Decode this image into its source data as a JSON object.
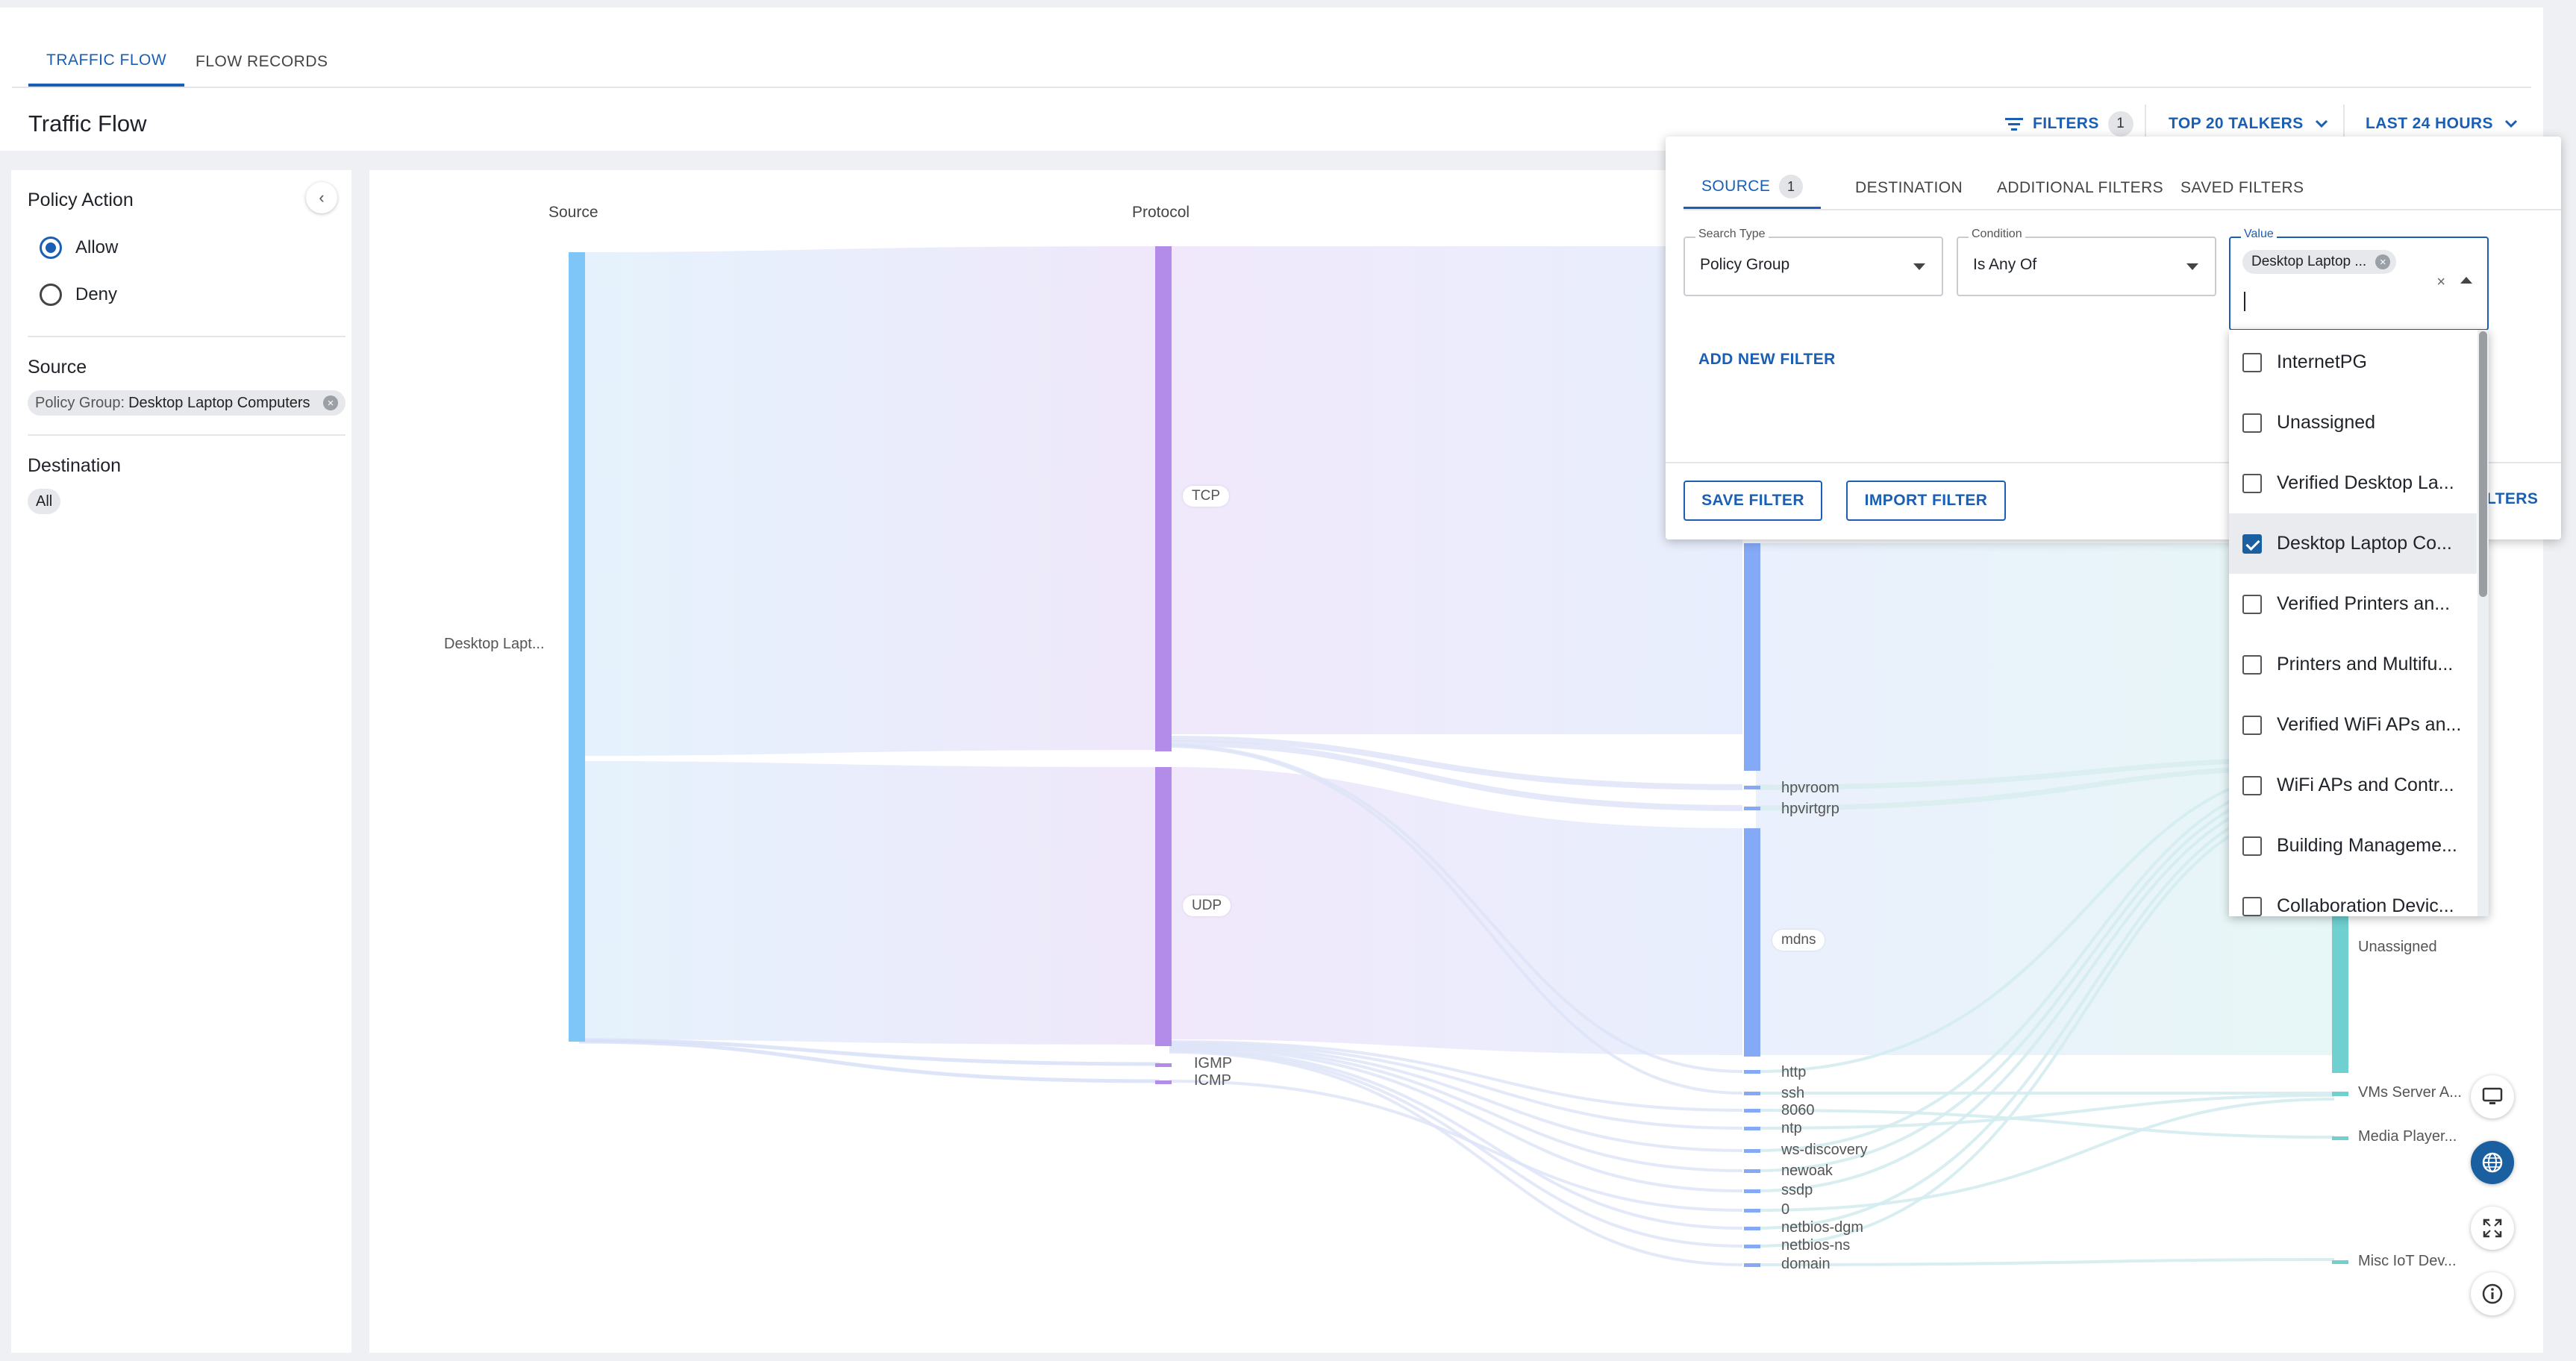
{
  "tabs": {
    "traffic_flow": "TRAFFIC FLOW",
    "flow_records": "FLOW RECORDS"
  },
  "page_title": "Traffic Flow",
  "header": {
    "filters_label": "FILTERS",
    "filters_count": "1",
    "top_talkers": "TOP 20 TALKERS",
    "time_range": "LAST 24 HOURS"
  },
  "left_panel": {
    "policy_action_title": "Policy Action",
    "allow": "Allow",
    "deny": "Deny",
    "source_title": "Source",
    "source_chip_label": "Policy Group:",
    "source_chip_value": "Desktop Laptop Computers",
    "destination_title": "Destination",
    "destination_chip": "All"
  },
  "sankey": {
    "col_source": "Source",
    "col_protocol": "Protocol",
    "source_node": "Desktop Lapt...",
    "protocols": [
      "TCP",
      "UDP",
      "IGMP",
      "ICMP"
    ],
    "services": [
      "hpvroom",
      "hpvirtgrp",
      "mdns",
      "http",
      "ssh",
      "8060",
      "ntp",
      "ws-discovery",
      "newoak",
      "ssdp",
      "0",
      "netbios-dgm",
      "netbios-ns",
      "domain"
    ],
    "destinations": [
      "Unassigned",
      "VMs Server A...",
      "Media Player...",
      "Misc IoT Dev..."
    ],
    "colors": {
      "source": "#7dc6f7",
      "protocol": "#b38be8",
      "service": "#84a9f5",
      "destination": "#6fd0cf"
    }
  },
  "filter_popup": {
    "tabs": {
      "source": "SOURCE",
      "source_count": "1",
      "destination": "DESTINATION",
      "additional": "ADDITIONAL FILTERS",
      "saved": "SAVED FILTERS"
    },
    "search_type_label": "Search Type",
    "search_type_value": "Policy Group",
    "condition_label": "Condition",
    "condition_value": "Is Any Of",
    "value_label": "Value",
    "value_chip": "Desktop Laptop ...",
    "add_new_filter": "ADD NEW FILTER",
    "save_filter": "SAVE FILTER",
    "import_filter": "IMPORT FILTER",
    "partial_button": "LTERS"
  },
  "dropdown_options": [
    {
      "label": "InternetPG",
      "checked": false
    },
    {
      "label": "Unassigned",
      "checked": false
    },
    {
      "label": "Verified Desktop La...",
      "checked": false
    },
    {
      "label": "Desktop Laptop Co...",
      "checked": true
    },
    {
      "label": "Verified Printers an...",
      "checked": false
    },
    {
      "label": "Printers and Multifu...",
      "checked": false
    },
    {
      "label": "Verified WiFi APs an...",
      "checked": false
    },
    {
      "label": "WiFi APs and Contr...",
      "checked": false
    },
    {
      "label": "Building Manageme...",
      "checked": false
    },
    {
      "label": "Collaboration Devic...",
      "checked": false
    }
  ]
}
